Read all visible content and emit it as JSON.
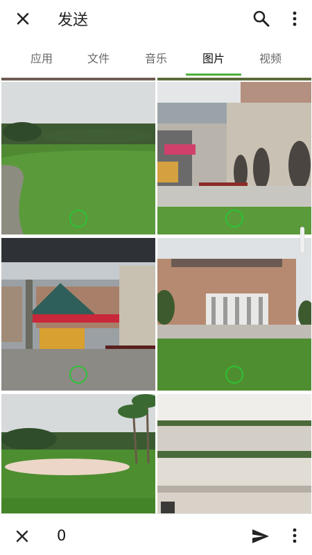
{
  "header": {
    "title": "发送",
    "close_icon": "close-icon",
    "search_icon": "search-icon",
    "more_icon": "more-vert-icon"
  },
  "tabs": [
    {
      "label": "应用",
      "active": false
    },
    {
      "label": "文件",
      "active": false
    },
    {
      "label": "音乐",
      "active": false
    },
    {
      "label": "图片",
      "active": true
    },
    {
      "label": "视频",
      "active": false
    }
  ],
  "accent_color": "#4fae3a",
  "selection_color": "#2ec036",
  "photos": [
    {
      "subject": "golf-course-fairway",
      "selected": false
    },
    {
      "subject": "building-courtyard-arches",
      "selected": false
    },
    {
      "subject": "covered-walkway-with-flowers",
      "selected": false
    },
    {
      "subject": "library-building-lawn",
      "selected": false
    },
    {
      "subject": "golf-course-bunker-palms",
      "selected": false
    },
    {
      "subject": "atrium-interior-balconies",
      "selected": false
    }
  ],
  "footer": {
    "selected_count": "0",
    "close_icon": "close-icon",
    "send_icon": "send-icon",
    "more_icon": "more-vert-icon"
  }
}
